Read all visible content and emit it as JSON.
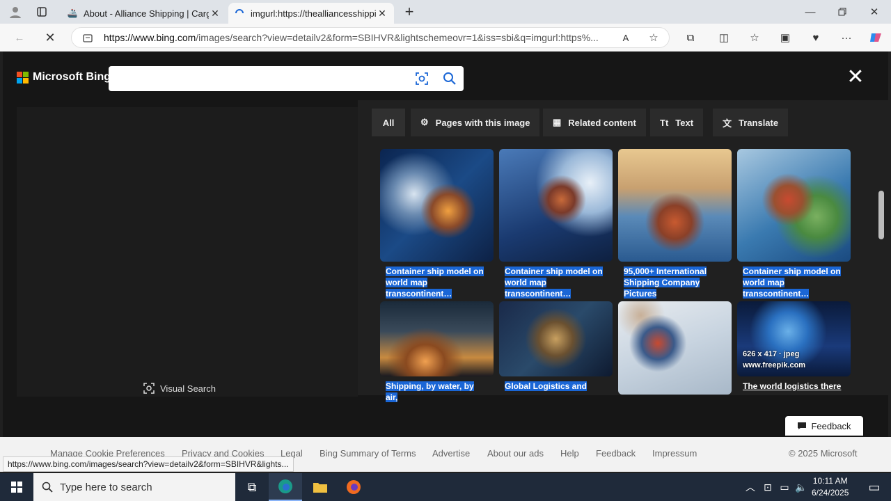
{
  "browser": {
    "tabs": [
      {
        "title": "About - Alliance Shipping | Cargo",
        "active": false
      },
      {
        "title": "imgurl:https://thealliancesshipping",
        "active": true
      }
    ],
    "url_host": "https://www.bing.com",
    "url_rest": "/images/search?view=detailv2&form=SBIHVR&lightschemeovr=1&iss=sbi&q=imgurl:https%..."
  },
  "bing": {
    "logo": "Microsoft Bing",
    "tabs": [
      "All",
      "Pages with this image",
      "Related content",
      "Text",
      "Translate"
    ],
    "visual_search": "Visual Search",
    "results": [
      {
        "caption": "Container ship model on world map transcontinent…",
        "style": "selected"
      },
      {
        "caption": "Container ship model on world map transcontinent…",
        "style": "selected"
      },
      {
        "caption": "95,000+ International Shipping Company Pictures",
        "style": "selected"
      },
      {
        "caption": "Container ship model on world map transcontinent…",
        "style": "selected"
      },
      {
        "caption": "Shipping, by water, by air,",
        "style": "selected"
      },
      {
        "caption": "Global Logistics and",
        "style": "selected"
      },
      {
        "caption": "",
        "style": "none"
      },
      {
        "caption": "The world logistics there",
        "style": "link",
        "meta_size": "626 x 417 · jpeg",
        "meta_site": "www.freepik.com"
      }
    ]
  },
  "footer": {
    "links": [
      "Manage Cookie Preferences",
      "Privacy and Cookies",
      "Legal",
      "Bing Summary of Terms",
      "Advertise",
      "About our ads",
      "Help",
      "Feedback",
      "Impressum"
    ],
    "copyright": "© 2025 Microsoft",
    "feedback_button": "Feedback"
  },
  "status_url": "https://www.bing.com/images/search?view=detailv2&form=SBIHVR&lights...",
  "taskbar": {
    "search_placeholder": "Type here to search",
    "time": "10:11 AM",
    "date": "6/24/2025"
  }
}
